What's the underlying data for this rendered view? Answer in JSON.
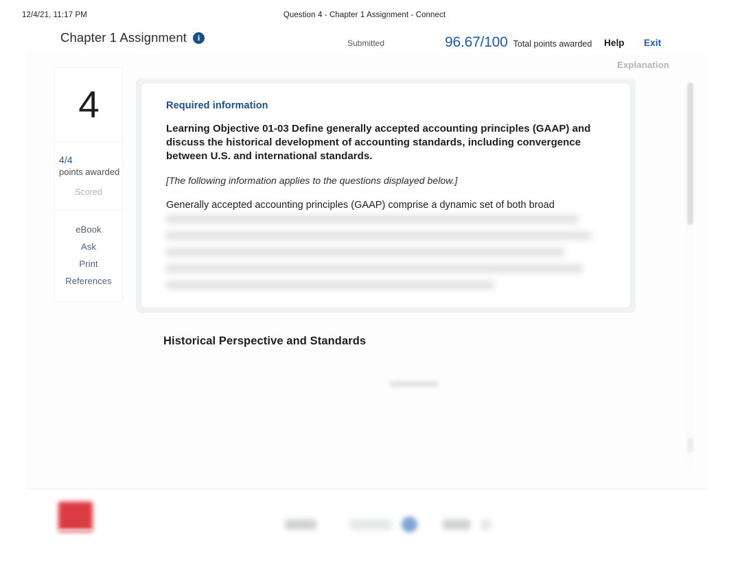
{
  "print_header": {
    "date": "12/4/21, 11:17 PM",
    "document_title": "Question 4 - Chapter 1 Assignment - Connect"
  },
  "header": {
    "assignment_title": "Chapter 1 Assignment",
    "info_icon_glyph": "i",
    "info_icon_name": "info-icon",
    "status": "Submitted",
    "score": "96.67/100",
    "score_caption": "Total points awarded",
    "help_label": "Help",
    "exit_label": "Exit",
    "accent_blue": "#1a5aa8",
    "info_icon_color": "#1b4f85"
  },
  "tabs": [
    {
      "label": "Explanation",
      "active": false,
      "color": "#b3b5b8"
    }
  ],
  "question_rail": {
    "number": "4",
    "points_value": "4/4",
    "points_label": "points awarded",
    "status": "Scored",
    "links": [
      {
        "label": "eBook"
      },
      {
        "label": "Ask"
      },
      {
        "label": "Print"
      },
      {
        "label": "References"
      }
    ]
  },
  "question": {
    "required_kicker": "Required information",
    "learning_objective": "Learning Objective 01-03 Define generally accepted accounting principles (GAAP) and discuss the historical development of accounting standards, including convergence between U.S. and international standards.",
    "applies_note": "[The following information applies to the questions displayed below.]",
    "paragraph_visible": "Generally accepted accounting principles (GAAP) comprise a dynamic set of both broad",
    "section_heading": "Historical Perspective and Standards",
    "redacted_lines": 5
  },
  "footer": {
    "brand_logo_name": "mcgraw-hill-logo",
    "brand_logo_color": "#d8262f",
    "toolbar_blurred": true
  },
  "scrollbar": {
    "thumb_position_percent": 0,
    "thumb_size_percent": 37
  }
}
